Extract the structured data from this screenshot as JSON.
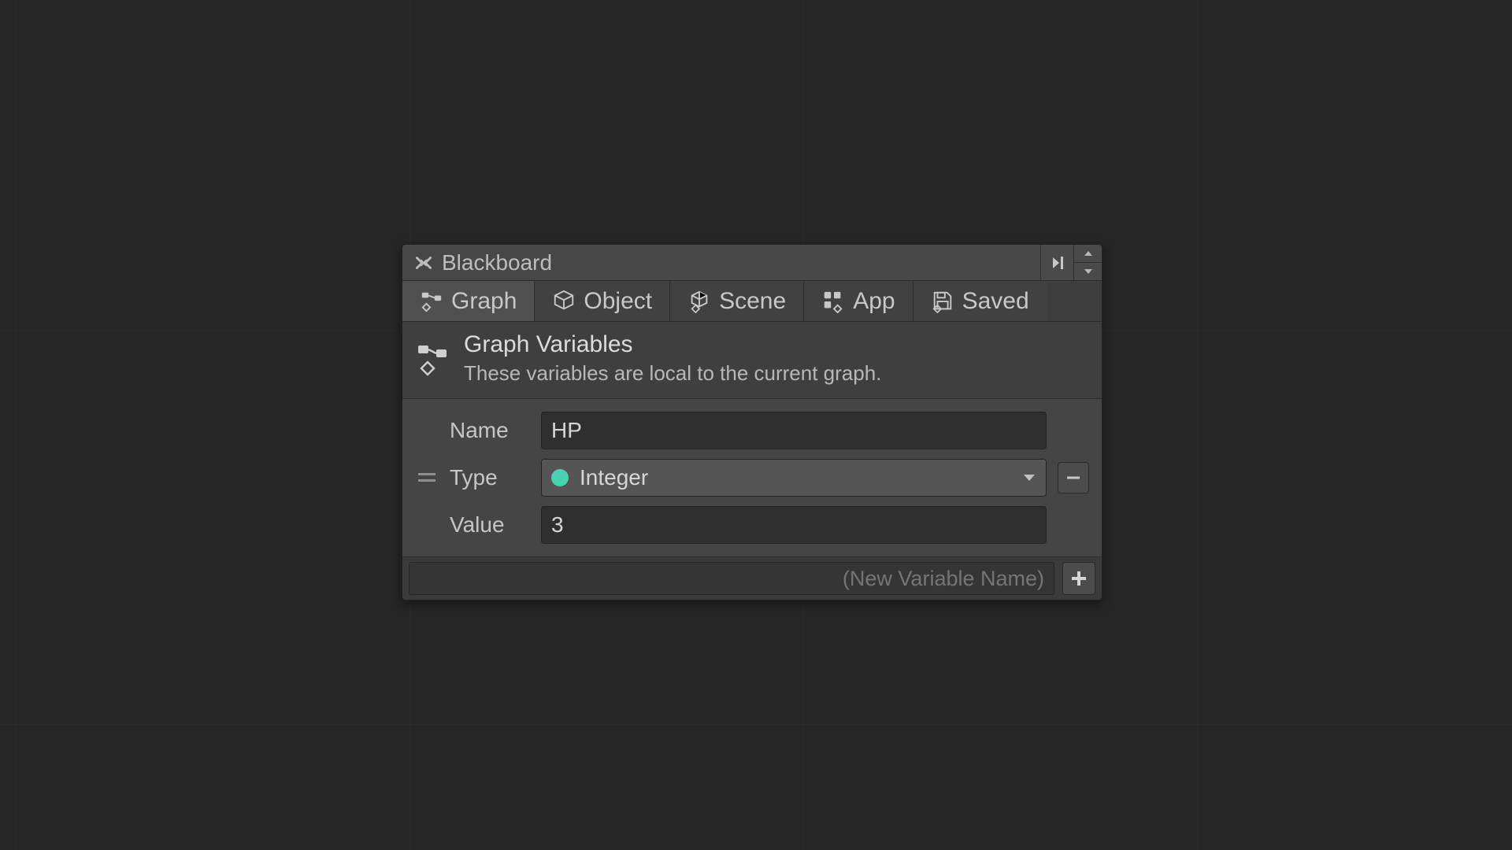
{
  "titlebar": {
    "title": "Blackboard"
  },
  "tabs": [
    {
      "label": "Graph",
      "active": true
    },
    {
      "label": "Object",
      "active": false
    },
    {
      "label": "Scene",
      "active": false
    },
    {
      "label": "App",
      "active": false
    },
    {
      "label": "Saved",
      "active": false
    }
  ],
  "section": {
    "title": "Graph Variables",
    "description": "These variables are local to the current graph."
  },
  "variable": {
    "name_label": "Name",
    "type_label": "Type",
    "value_label": "Value",
    "name_value": "HP",
    "type_value": "Integer",
    "value_value": "3",
    "type_color": "#49d1b4"
  },
  "footer": {
    "new_var_placeholder": "(New Variable Name)"
  }
}
